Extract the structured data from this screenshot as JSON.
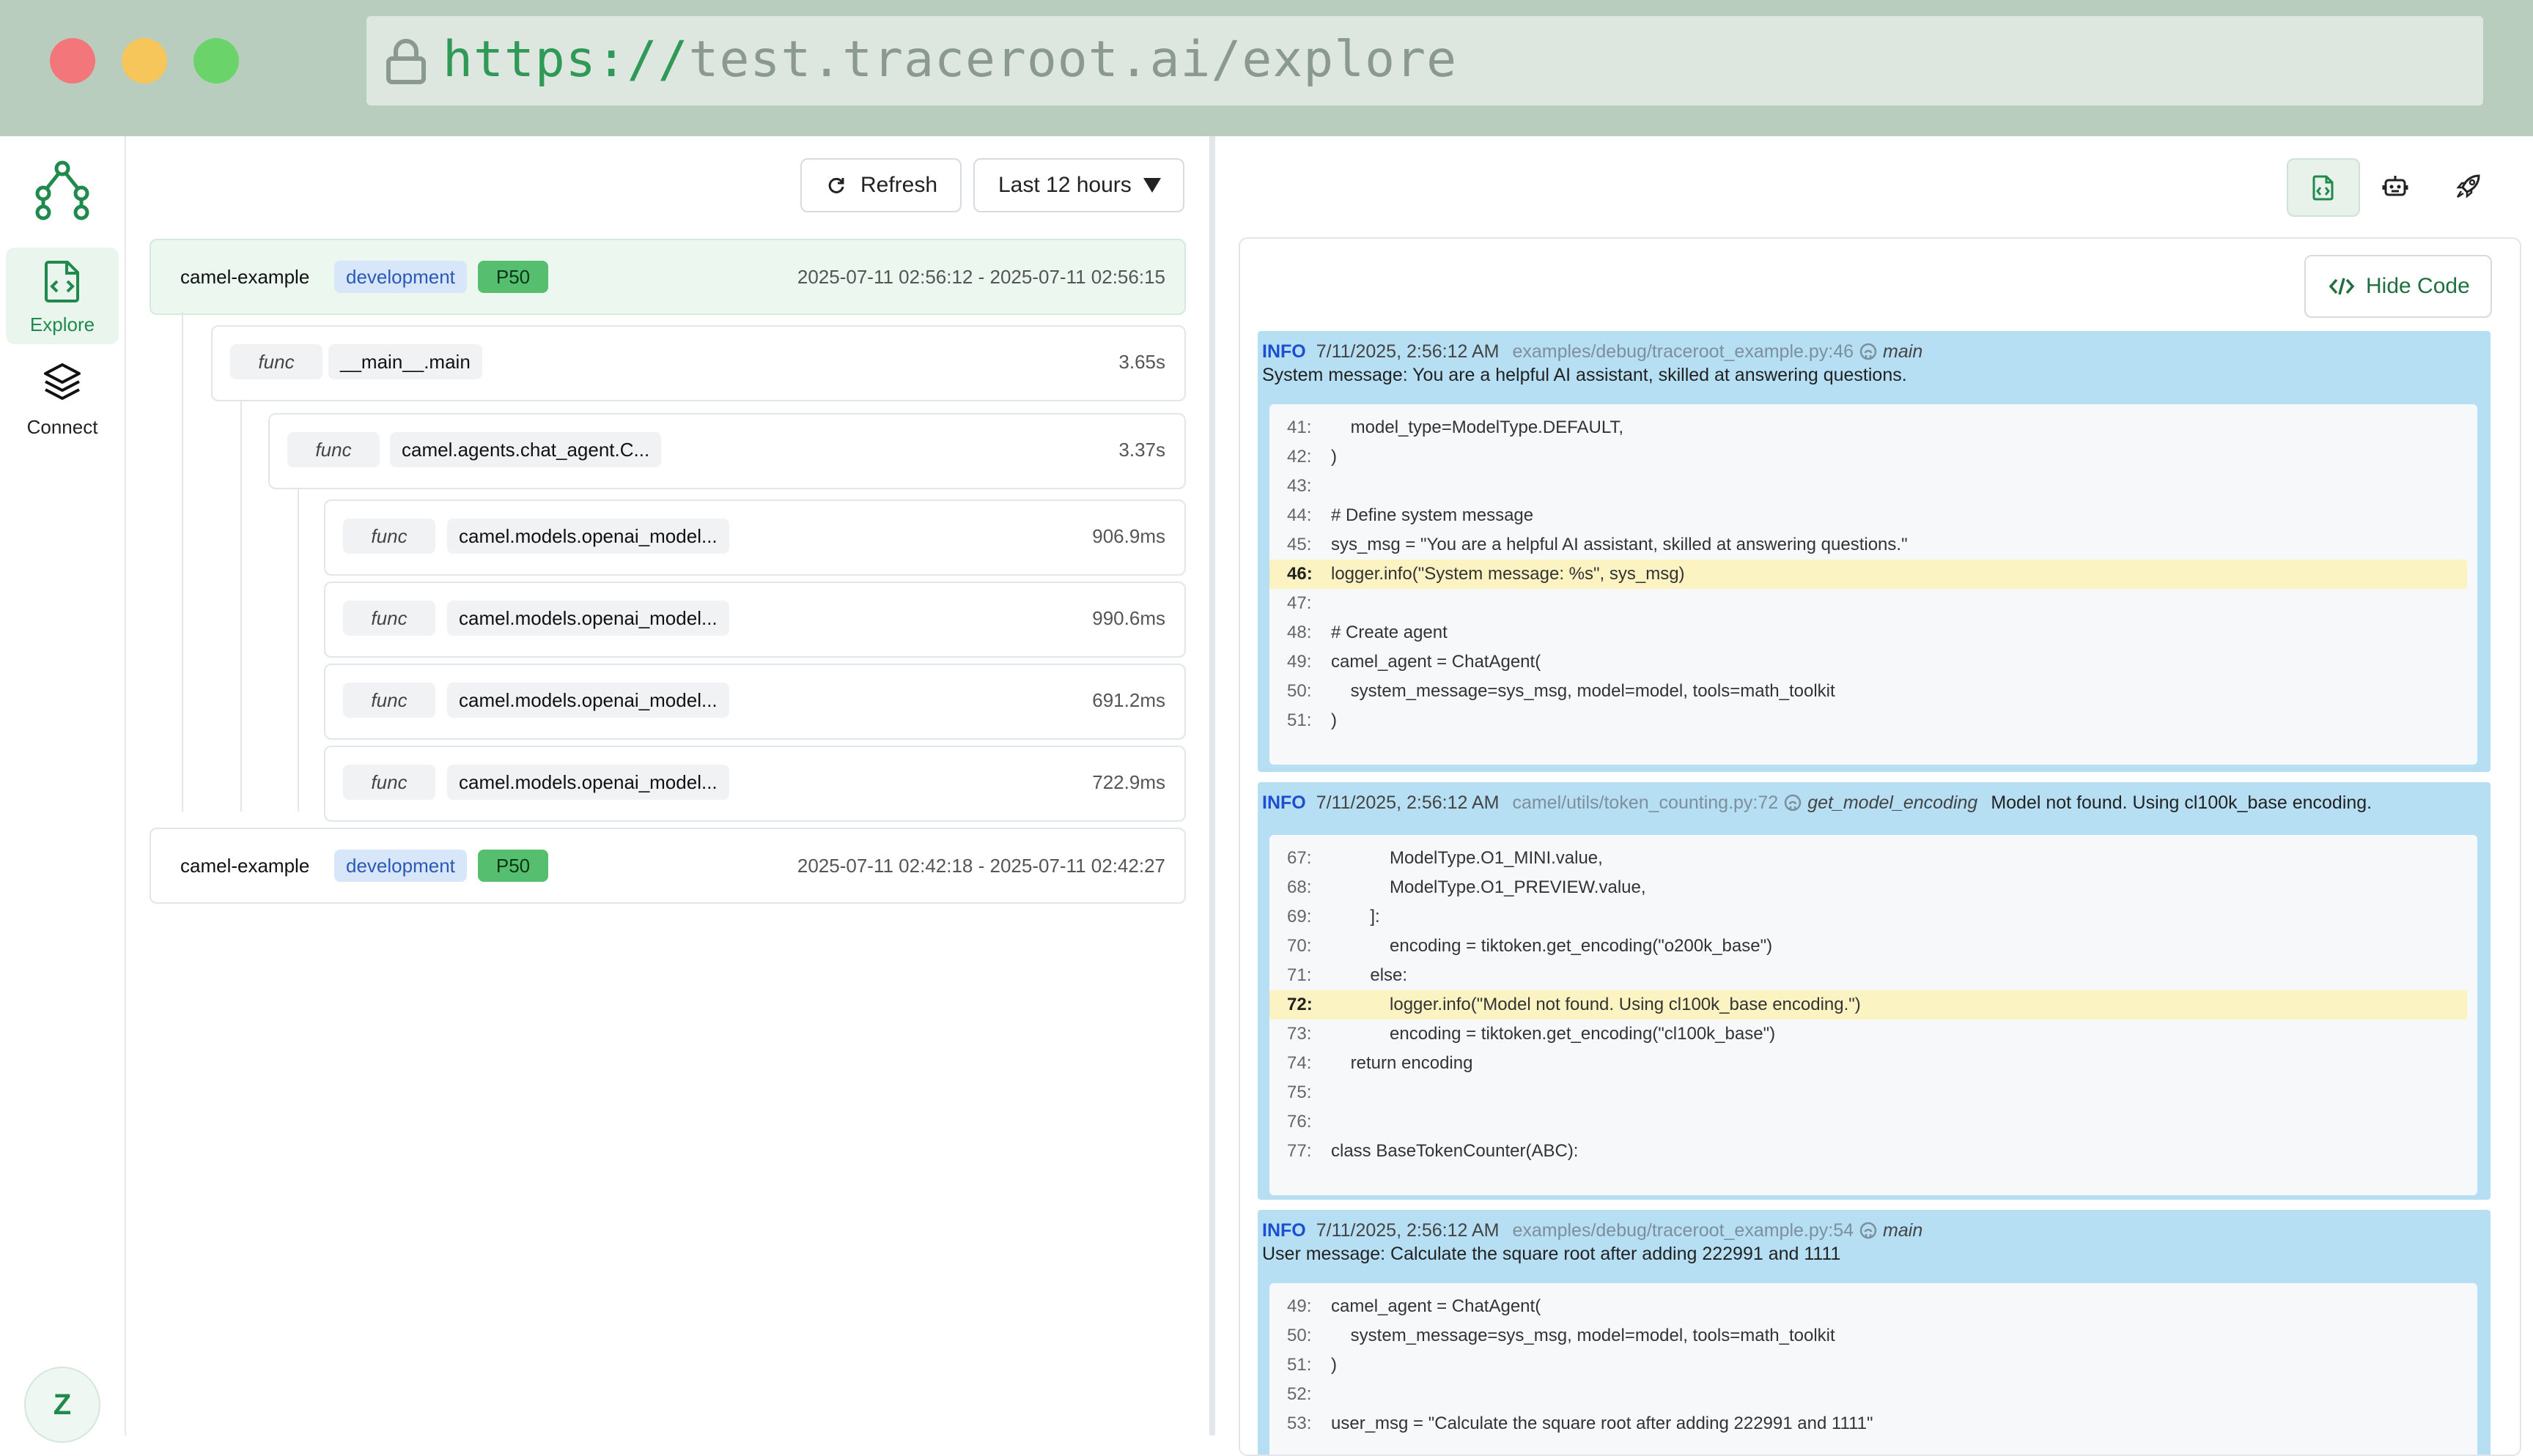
{
  "browser": {
    "url_scheme": "https://",
    "url_rest": "test.traceroot.ai/explore"
  },
  "sidebar": {
    "logo_icon": "traceroot-logo-icon",
    "items": [
      {
        "label": "Explore",
        "icon": "explore-code-file-icon",
        "active": true
      },
      {
        "label": "Connect",
        "icon": "layers-stack-icon",
        "active": false
      }
    ],
    "avatar_letter": "Z"
  },
  "toolbar": {
    "refresh_label": "Refresh",
    "time_range": "Last 12 hours"
  },
  "traces": [
    {
      "service": "camel-example",
      "env": "development",
      "percentile": "P50",
      "time_range": "2025-07-11 02:56:12 - 2025-07-11 02:56:15",
      "spans": [
        {
          "kind": "func",
          "name": "__main__.main",
          "duration": "3.65s"
        },
        {
          "kind": "func",
          "name": "camel.agents.chat_agent.C...",
          "duration": "3.37s"
        },
        {
          "kind": "func",
          "name": "camel.models.openai_model...",
          "duration": "906.9ms"
        },
        {
          "kind": "func",
          "name": "camel.models.openai_model...",
          "duration": "990.6ms"
        },
        {
          "kind": "func",
          "name": "camel.models.openai_model...",
          "duration": "691.2ms"
        },
        {
          "kind": "func",
          "name": "camel.models.openai_model...",
          "duration": "722.9ms"
        }
      ]
    },
    {
      "service": "camel-example",
      "env": "development",
      "percentile": "P50",
      "time_range": "2025-07-11 02:42:18 - 2025-07-11 02:42:27"
    }
  ],
  "right_toolbar": {
    "icons": [
      "code-file-icon",
      "robot-icon",
      "rocket-icon"
    ],
    "hide_code_label": "Hide Code"
  },
  "logs": [
    {
      "level": "INFO",
      "time": "7/11/2025, 2:56:12 AM",
      "source": "examples/debug/traceroot_example.py:46",
      "function": "main",
      "message": "System message: You are a helpful AI assistant, skilled at answering questions.",
      "code": [
        {
          "ln": "41:",
          "text": "    model_type=ModelType.DEFAULT,"
        },
        {
          "ln": "42:",
          "text": ")"
        },
        {
          "ln": "43:",
          "text": ""
        },
        {
          "ln": "44:",
          "text": "# Define system message"
        },
        {
          "ln": "45:",
          "text": "sys_msg = \"You are a helpful AI assistant, skilled at answering questions.\""
        },
        {
          "ln": "46:",
          "text": "logger.info(\"System message: %s\", sys_msg)",
          "highlight": true
        },
        {
          "ln": "47:",
          "text": ""
        },
        {
          "ln": "48:",
          "text": "# Create agent"
        },
        {
          "ln": "49:",
          "text": "camel_agent = ChatAgent("
        },
        {
          "ln": "50:",
          "text": "    system_message=sys_msg, model=model, tools=math_toolkit"
        },
        {
          "ln": "51:",
          "text": ")"
        }
      ]
    },
    {
      "level": "INFO",
      "time": "7/11/2025, 2:56:12 AM",
      "source": "camel/utils/token_counting.py:72",
      "function": "get_model_encoding",
      "message": "Model not found. Using cl100k_base encoding.",
      "code": [
        {
          "ln": "67:",
          "text": "            ModelType.O1_MINI.value,"
        },
        {
          "ln": "68:",
          "text": "            ModelType.O1_PREVIEW.value,"
        },
        {
          "ln": "69:",
          "text": "        ]:"
        },
        {
          "ln": "70:",
          "text": "            encoding = tiktoken.get_encoding(\"o200k_base\")"
        },
        {
          "ln": "71:",
          "text": "        else:"
        },
        {
          "ln": "72:",
          "text": "            logger.info(\"Model not found. Using cl100k_base encoding.\")",
          "highlight": true
        },
        {
          "ln": "73:",
          "text": "            encoding = tiktoken.get_encoding(\"cl100k_base\")"
        },
        {
          "ln": "74:",
          "text": "    return encoding"
        },
        {
          "ln": "75:",
          "text": ""
        },
        {
          "ln": "76:",
          "text": ""
        },
        {
          "ln": "77:",
          "text": "class BaseTokenCounter(ABC):"
        }
      ]
    },
    {
      "level": "INFO",
      "time": "7/11/2025, 2:56:12 AM",
      "source": "examples/debug/traceroot_example.py:54",
      "function": "main",
      "message": "User message: Calculate the square root after adding 222991 and 1111",
      "code": [
        {
          "ln": "49:",
          "text": "camel_agent = ChatAgent("
        },
        {
          "ln": "50:",
          "text": "    system_message=sys_msg, model=model, tools=math_toolkit"
        },
        {
          "ln": "51:",
          "text": ")"
        },
        {
          "ln": "52:",
          "text": ""
        },
        {
          "ln": "53:",
          "text": "user_msg = \"Calculate the square root after adding 222991 and 1111\""
        }
      ]
    }
  ]
}
